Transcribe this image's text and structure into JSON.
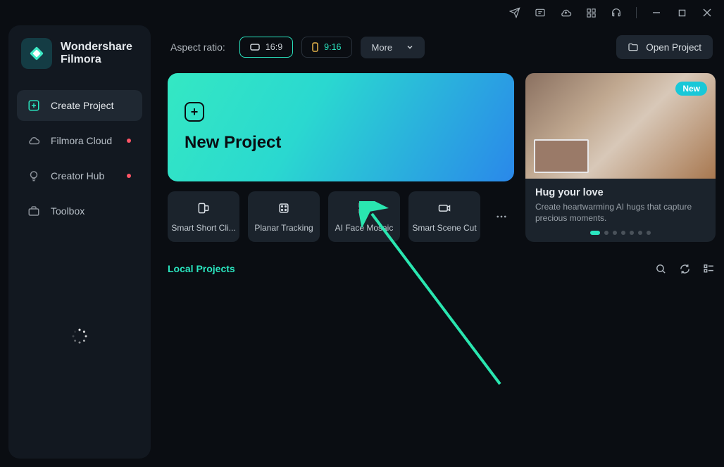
{
  "brand": {
    "line1": "Wondershare",
    "line2": "Filmora"
  },
  "sidebar": {
    "items": [
      {
        "label": "Create Project"
      },
      {
        "label": "Filmora Cloud"
      },
      {
        "label": "Creator Hub"
      },
      {
        "label": "Toolbox"
      }
    ]
  },
  "toolbar": {
    "aspect_label": "Aspect ratio:",
    "ratio1": "16:9",
    "ratio2": "9:16",
    "more_label": "More",
    "open_project": "Open Project"
  },
  "hero": {
    "new_project": "New Project"
  },
  "feature": {
    "badge": "New",
    "title": "Hug your love",
    "desc": "Create heartwarming AI hugs that capture precious moments."
  },
  "tools": [
    {
      "label": "Smart Short Cli..."
    },
    {
      "label": "Planar Tracking"
    },
    {
      "label": "AI Face Mosaic"
    },
    {
      "label": "Smart Scene Cut"
    }
  ],
  "local": {
    "title": "Local Projects"
  }
}
